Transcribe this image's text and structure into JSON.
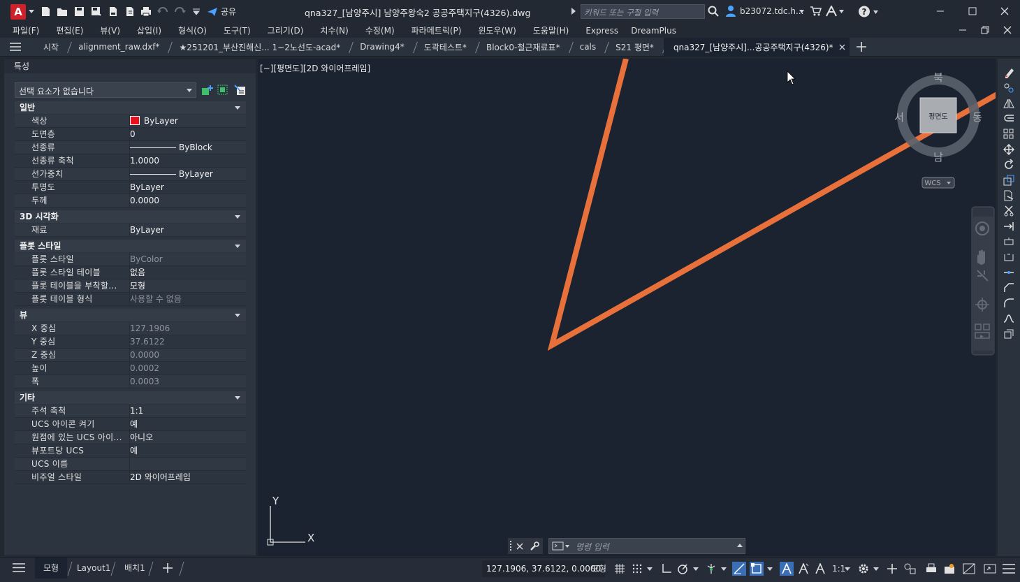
{
  "app": {
    "logo_letter": "A",
    "share_label": "공유",
    "title": "qna327_[남양주시] 남양주왕숙2 공공주택지구(4326).dwg",
    "search_placeholder": "키워드 또는 구절 입력",
    "user": "b23072.tdc.h..."
  },
  "menu": [
    "파일(F)",
    "편집(E)",
    "뷰(V)",
    "삽입(I)",
    "형식(O)",
    "도구(T)",
    "그리기(D)",
    "치수(N)",
    "수정(M)",
    "파라메트릭(P)",
    "윈도우(W)",
    "도움말(H)",
    "Express",
    "DreamPlus"
  ],
  "tabs": [
    {
      "label": "시작"
    },
    {
      "label": "alignment_raw.dxf*"
    },
    {
      "label": "★251201_부산진해신... 1~2노선도-acad*"
    },
    {
      "label": "Drawing4*"
    },
    {
      "label": "도곽테스트*"
    },
    {
      "label": "Block0-철근재료표*"
    },
    {
      "label": "cals"
    },
    {
      "label": "S21 평면*"
    },
    {
      "label": "qna327_[남양주시]...공공주택지구(4326)*"
    }
  ],
  "properties": {
    "panel_title": "특성",
    "selection": "선택 요소가 없습니다",
    "sections": {
      "general": "일반",
      "visual3d": "3D 시각화",
      "plotstyle": "플롯 스타일",
      "view": "뷰",
      "misc": "기타"
    },
    "general": [
      {
        "k": "색상",
        "v": "ByLayer"
      },
      {
        "k": "도면층",
        "v": "0"
      },
      {
        "k": "선종류",
        "v": "ByBlock"
      },
      {
        "k": "선종류 축척",
        "v": "1.0000"
      },
      {
        "k": "선가중치",
        "v": "ByLayer"
      },
      {
        "k": "투명도",
        "v": "ByLayer"
      },
      {
        "k": "두께",
        "v": "0.0000"
      }
    ],
    "visual3d": [
      {
        "k": "재료",
        "v": "ByLayer"
      }
    ],
    "plotstyle": [
      {
        "k": "플롯 스타일",
        "v": "ByColor"
      },
      {
        "k": "플롯 스타일 테이블",
        "v": "없음"
      },
      {
        "k": "플롯 테이블을 부착할...",
        "v": "모형"
      },
      {
        "k": "플롯 테이블 형식",
        "v": "사용할 수 없음"
      }
    ],
    "view": [
      {
        "k": "X 중심",
        "v": "127.1906"
      },
      {
        "k": "Y 중심",
        "v": "37.6122"
      },
      {
        "k": "Z 중심",
        "v": "0.0000"
      },
      {
        "k": "높이",
        "v": "0.0002"
      },
      {
        "k": "폭",
        "v": "0.0003"
      }
    ],
    "misc": [
      {
        "k": "주석 축척",
        "v": "1:1"
      },
      {
        "k": "UCS 아이콘 켜기",
        "v": "예"
      },
      {
        "k": "원점에 있는 UCS 아이...",
        "v": "아니오"
      },
      {
        "k": "뷰포트당 UCS",
        "v": "예"
      },
      {
        "k": "UCS 이름",
        "v": ""
      },
      {
        "k": "비주얼 스타일",
        "v": "2D 와이어프레임"
      }
    ]
  },
  "viewport": {
    "label": "[−][평면도][2D 와이어프레임]",
    "viewcube": {
      "north": "북",
      "south": "남",
      "east": "동",
      "west": "서",
      "face": "평면도",
      "wcs": "WCS"
    },
    "ucs_x": "X",
    "ucs_y": "Y",
    "line_color": "#e8703a"
  },
  "command": {
    "placeholder": "명령 입력"
  },
  "status": {
    "model_tab": "모형",
    "layout1": "Layout1",
    "layout2": "배치1",
    "coords": "127.1906, 37.6122, 0.0000",
    "model_btn": "모형",
    "scale": "1:1"
  }
}
